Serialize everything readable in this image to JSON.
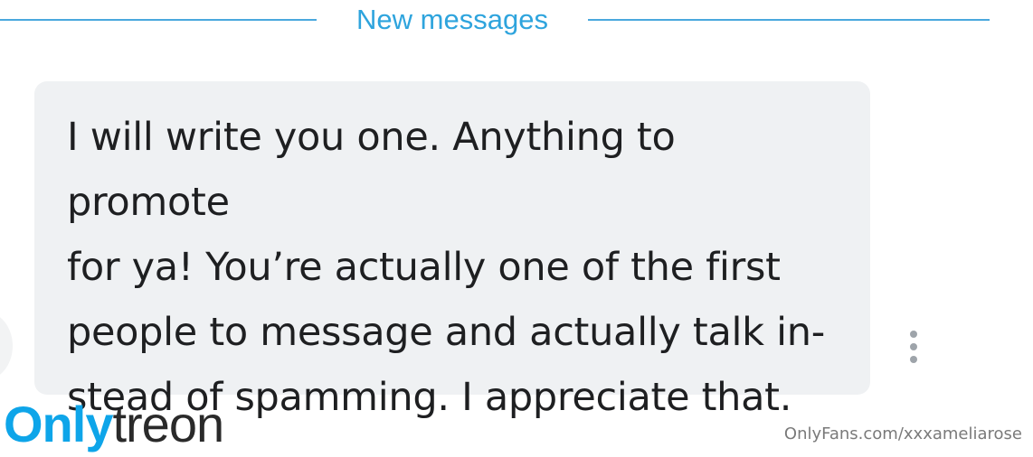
{
  "divider": {
    "label": "New messages",
    "color": "#2ea4dd"
  },
  "message": {
    "lines": [
      "I will write you one. Anything to promote",
      "for ya! You’re actually one of the first",
      "people to message and actually talk in-",
      "stead of spamming. I appreciate that."
    ],
    "bubble_color": "#eff1f3"
  },
  "message_menu": {
    "icon": "more-vertical-icon"
  },
  "watermark": {
    "logo_part1": "Only",
    "logo_part2": "treon",
    "url": "OnlyFans.com/xxxameliarose"
  }
}
